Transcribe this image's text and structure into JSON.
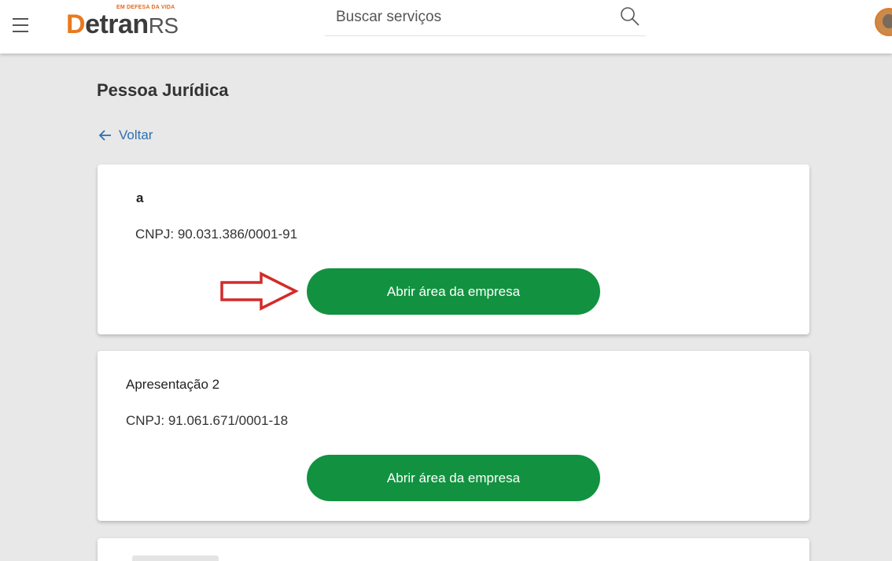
{
  "header": {
    "logo_tagline": "EM DEFESA DA VIDA",
    "logo_first_letter": "D",
    "logo_word": "etran",
    "logo_suffix": "RS",
    "search_placeholder": "Buscar serviços"
  },
  "page": {
    "title": "Pessoa Jurídica",
    "back_label": "Voltar"
  },
  "companies": [
    {
      "name": "a",
      "cnpj": "CNPJ: 90.031.386/0001-91",
      "button_label": "Abrir área da empresa"
    },
    {
      "name": "Apresentação 2",
      "cnpj": "CNPJ: 91.061.671/0001-18",
      "button_label": "Abrir área da empresa"
    }
  ],
  "colors": {
    "accent_green": "#129240",
    "link_blue": "#2f6fb0",
    "logo_orange": "#e87a1d",
    "annotation_red": "#d42a2a"
  },
  "icons": [
    "menu-icon",
    "search-icon",
    "avatar",
    "back-arrow-icon",
    "annotation-arrow-icon"
  ]
}
